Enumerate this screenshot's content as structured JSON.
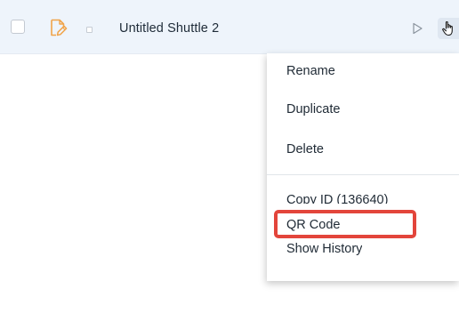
{
  "row": {
    "title": "Untitled Shuttle 2",
    "icons": {
      "checkbox": "checkbox-icon",
      "shuttle": "shuttle-edit-icon",
      "status": "small-square-icon",
      "run": "play-icon",
      "cursor": "hand-cursor-icon"
    }
  },
  "context_menu": {
    "items": [
      {
        "label": "Rename"
      },
      {
        "label": "Duplicate"
      },
      {
        "label": "Delete"
      },
      {
        "label": "Copy ID (136640)"
      },
      {
        "label": "QR Code"
      },
      {
        "label": "Show History"
      }
    ]
  },
  "colors": {
    "row_background": "#eef4fb",
    "shuttle_icon": "#f0a44a",
    "highlight": "#e3453b",
    "text": "#1f2a35"
  }
}
